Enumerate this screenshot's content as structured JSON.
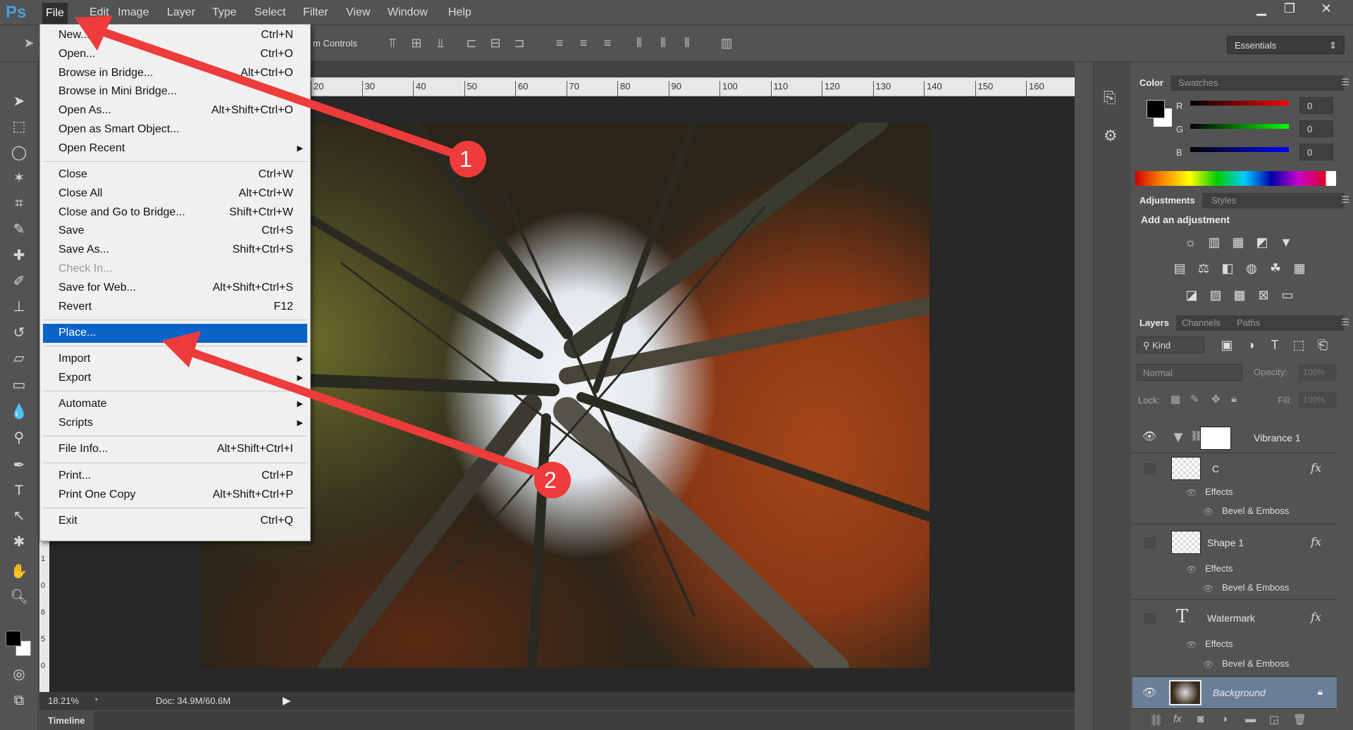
{
  "app": {
    "logo": "Ps",
    "menu": [
      "File",
      "Edit",
      "Image",
      "Layer",
      "Type",
      "Select",
      "Filter",
      "View",
      "Window",
      "Help"
    ],
    "window_controls": {
      "minimize": "▁",
      "restore": "❐",
      "close": "✕"
    }
  },
  "options_bar": {
    "transform_label": "m Controls",
    "workspace": "Essentials"
  },
  "ruler": {
    "labels": [
      "20",
      "30",
      "40",
      "50",
      "60",
      "70",
      "80",
      "90",
      "100",
      "110",
      "120",
      "130",
      "140",
      "150",
      "160"
    ],
    "vertical": [
      "1",
      "1",
      "0",
      "6",
      "5",
      "0"
    ]
  },
  "file_menu": [
    {
      "label": "New...",
      "shortcut": "Ctrl+N"
    },
    {
      "label": "Open...",
      "shortcut": "Ctrl+O"
    },
    {
      "label": "Browse in Bridge...",
      "shortcut": "Alt+Ctrl+O"
    },
    {
      "label": "Browse in Mini Bridge...",
      "shortcut": ""
    },
    {
      "label": "Open As...",
      "shortcut": "Alt+Shift+Ctrl+O"
    },
    {
      "label": "Open as Smart Object...",
      "shortcut": ""
    },
    {
      "label": "Open Recent",
      "shortcut": "",
      "submenu": true
    },
    {
      "sep": true
    },
    {
      "label": "Close",
      "shortcut": "Ctrl+W"
    },
    {
      "label": "Close All",
      "shortcut": "Alt+Ctrl+W"
    },
    {
      "label": "Close and Go to Bridge...",
      "shortcut": "Shift+Ctrl+W"
    },
    {
      "label": "Save",
      "shortcut": "Ctrl+S"
    },
    {
      "label": "Save As...",
      "shortcut": "Shift+Ctrl+S"
    },
    {
      "label": "Check In...",
      "shortcut": "",
      "disabled": true
    },
    {
      "label": "Save for Web...",
      "shortcut": "Alt+Shift+Ctrl+S"
    },
    {
      "label": "Revert",
      "shortcut": "F12"
    },
    {
      "sep": true
    },
    {
      "label": "Place...",
      "shortcut": "",
      "highlighted": true
    },
    {
      "sep": true
    },
    {
      "label": "Import",
      "shortcut": "",
      "submenu": true
    },
    {
      "label": "Export",
      "shortcut": "",
      "submenu": true
    },
    {
      "sep": true
    },
    {
      "label": "Automate",
      "shortcut": "",
      "submenu": true
    },
    {
      "label": "Scripts",
      "shortcut": "",
      "submenu": true
    },
    {
      "sep": true
    },
    {
      "label": "File Info...",
      "shortcut": "Alt+Shift+Ctrl+I"
    },
    {
      "sep": true
    },
    {
      "label": "Print...",
      "shortcut": "Ctrl+P"
    },
    {
      "label": "Print One Copy",
      "shortcut": "Alt+Shift+Ctrl+P"
    },
    {
      "sep": true
    },
    {
      "label": "Exit",
      "shortcut": "Ctrl+Q"
    }
  ],
  "annotations": {
    "step1": "1",
    "step2": "2",
    "arrow_color": "#ee3b3b"
  },
  "status": {
    "zoom": "18.21%",
    "doc": "Doc: 34.9M/60.6M",
    "timeline": "Timeline"
  },
  "color_panel": {
    "tabs": [
      "Color",
      "Swatches"
    ],
    "channels": [
      {
        "label": "R",
        "value": "0"
      },
      {
        "label": "G",
        "value": "0"
      },
      {
        "label": "B",
        "value": "0"
      }
    ],
    "foreground": "#000000",
    "background": "#ffffff"
  },
  "adjustments_panel": {
    "tabs": [
      "Adjustments",
      "Styles"
    ],
    "heading": "Add an adjustment"
  },
  "layers_panel": {
    "tabs": [
      "Layers",
      "Channels",
      "Paths"
    ],
    "filter": "Kind",
    "blend_mode": "Normal",
    "opacity_label": "Opacity:",
    "opacity": "100%",
    "lock_label": "Lock:",
    "fill_label": "Fill:",
    "fill": "100%",
    "layers": [
      {
        "name": "Vibrance 1",
        "visible": true
      },
      {
        "name": "C",
        "visible": false,
        "effects": "Effects",
        "effect": "Bevel & Emboss"
      },
      {
        "name": "Shape 1",
        "visible": false,
        "effects": "Effects",
        "effect": "Bevel & Emboss"
      },
      {
        "name": "Watermark",
        "visible": false,
        "effects": "Effects",
        "effect": "Bevel & Emboss"
      },
      {
        "name": "Background",
        "visible": true,
        "selected": true
      }
    ]
  }
}
